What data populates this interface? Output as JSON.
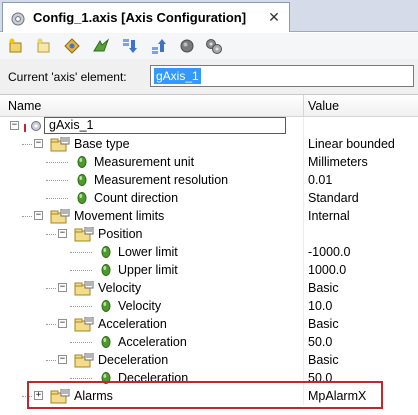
{
  "tab": {
    "title": "Config_1.axis [Axis Configuration]",
    "close_glyph": "✕",
    "icon": "axis-config-icon"
  },
  "toolbar": {
    "buttons": [
      "new-element-icon",
      "add-element-icon",
      "navigate-icon",
      "expand-icon",
      "move-down-icon",
      "move-up-icon",
      "stop-icon",
      "settings-gears-icon"
    ]
  },
  "element": {
    "label": "Current 'axis' element:",
    "value": "gAxis_1"
  },
  "grid": {
    "headers": {
      "name": "Name",
      "value": "Value"
    },
    "rows": [
      {
        "label": "gAxis_1",
        "value": "",
        "kind": "root"
      },
      {
        "label": "Base type",
        "value": "Linear bounded",
        "kind": "group"
      },
      {
        "label": "Measurement unit",
        "value": "Millimeters",
        "kind": "param"
      },
      {
        "label": "Measurement resolution",
        "value": "0.01",
        "kind": "param"
      },
      {
        "label": "Count direction",
        "value": "Standard",
        "kind": "param"
      },
      {
        "label": "Movement limits",
        "value": "Internal",
        "kind": "group"
      },
      {
        "label": "Position",
        "value": "",
        "kind": "group"
      },
      {
        "label": "Lower limit",
        "value": "-1000.0",
        "kind": "param"
      },
      {
        "label": "Upper limit",
        "value": "1000.0",
        "kind": "param"
      },
      {
        "label": "Velocity",
        "value": "Basic",
        "kind": "group"
      },
      {
        "label": "Velocity",
        "value": "10.0",
        "kind": "param"
      },
      {
        "label": "Acceleration",
        "value": "Basic",
        "kind": "group"
      },
      {
        "label": "Acceleration",
        "value": "50.0",
        "kind": "param"
      },
      {
        "label": "Deceleration",
        "value": "Basic",
        "kind": "group"
      },
      {
        "label": "Deceleration",
        "value": "50.0",
        "kind": "param"
      },
      {
        "label": "Alarms",
        "value": "MpAlarmX",
        "kind": "group"
      }
    ]
  },
  "colors": {
    "highlight": "#c0282d",
    "selection": "#3399ff",
    "param_dot": "#4f9a2e"
  }
}
